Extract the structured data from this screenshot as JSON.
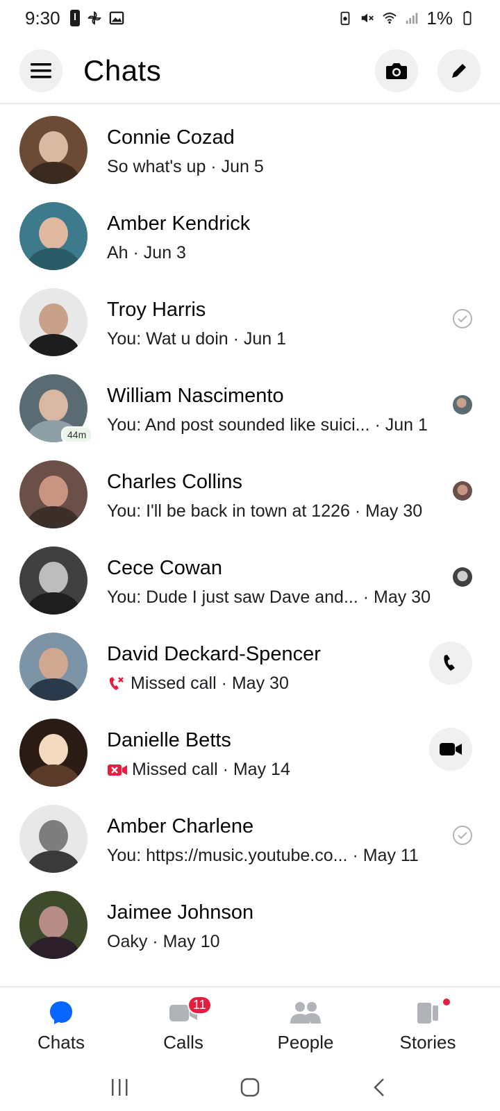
{
  "status_bar": {
    "time": "9:30",
    "battery": "1%"
  },
  "header": {
    "title": "Chats",
    "icons": [
      "menu-icon",
      "camera-icon",
      "edit-icon"
    ]
  },
  "chats": [
    {
      "name": "Connie Cozad",
      "preview": "So what's up · Jun 5",
      "right": "none",
      "avatar_colors": [
        "#6b4a36",
        "#d9b9a0"
      ]
    },
    {
      "name": "Amber Kendrick",
      "preview": "Ah · Jun 3",
      "right": "none",
      "avatar_colors": [
        "#3c7a8c",
        "#e0b8a0"
      ]
    },
    {
      "name": "Troy Harris",
      "preview": "You: Wat u doin · Jun 1",
      "right": "sent-check-icon",
      "avatar_colors": [
        "#1d1d1d",
        "#c9a08a"
      ]
    },
    {
      "name": "William Nascimento",
      "preview": "You: And post sounded like suici... · Jun 1",
      "right": "seen-avatar",
      "active_badge": "44m",
      "avatar_colors": [
        "#5a6b73",
        "#d8b7a3"
      ]
    },
    {
      "name": "Charles Collins",
      "preview": "You: I'll be back in town at 1226 · May 30",
      "right": "seen-avatar",
      "avatar_colors": [
        "#6a5048",
        "#c99580"
      ]
    },
    {
      "name": "Cece Cowan",
      "preview": "You: Dude I just saw Dave and... · May 30",
      "right": "seen-avatar",
      "avatar_colors": [
        "#404040",
        "#bdbdbd"
      ]
    },
    {
      "name": "David Deckard-Spencer",
      "preview": "Missed call · May 30",
      "missed": "phone",
      "right": "phone-call-button",
      "avatar_colors": [
        "#2a3a4a",
        "#d0a88f"
      ]
    },
    {
      "name": "Danielle Betts",
      "preview": "Missed call · May 14",
      "missed": "video",
      "right": "video-call-button",
      "avatar_colors": [
        "#2a1c14",
        "#f2d9c0"
      ]
    },
    {
      "name": "Amber Charlene",
      "preview": "You: https://music.youtube.co... · May 11",
      "right": "sent-check-icon",
      "avatar_colors": [
        "#7d7d7d",
        "#e8e8e8"
      ]
    },
    {
      "name": "Jaimee Johnson",
      "preview": "Oaky · May 10",
      "right": "none",
      "avatar_colors": [
        "#3d4a2c",
        "#b68c86"
      ]
    }
  ],
  "bottom_nav": {
    "items": [
      {
        "label": "Chats",
        "icon": "chat-bubble-icon",
        "active": true
      },
      {
        "label": "Calls",
        "icon": "video-camera-icon",
        "badge": "11"
      },
      {
        "label": "People",
        "icon": "people-icon"
      },
      {
        "label": "Stories",
        "icon": "stories-icon",
        "dot": true
      }
    ]
  },
  "colors": {
    "accent": "#0866ff",
    "missed": "#e41e3f",
    "muted_icon": "#b0b3b8"
  }
}
